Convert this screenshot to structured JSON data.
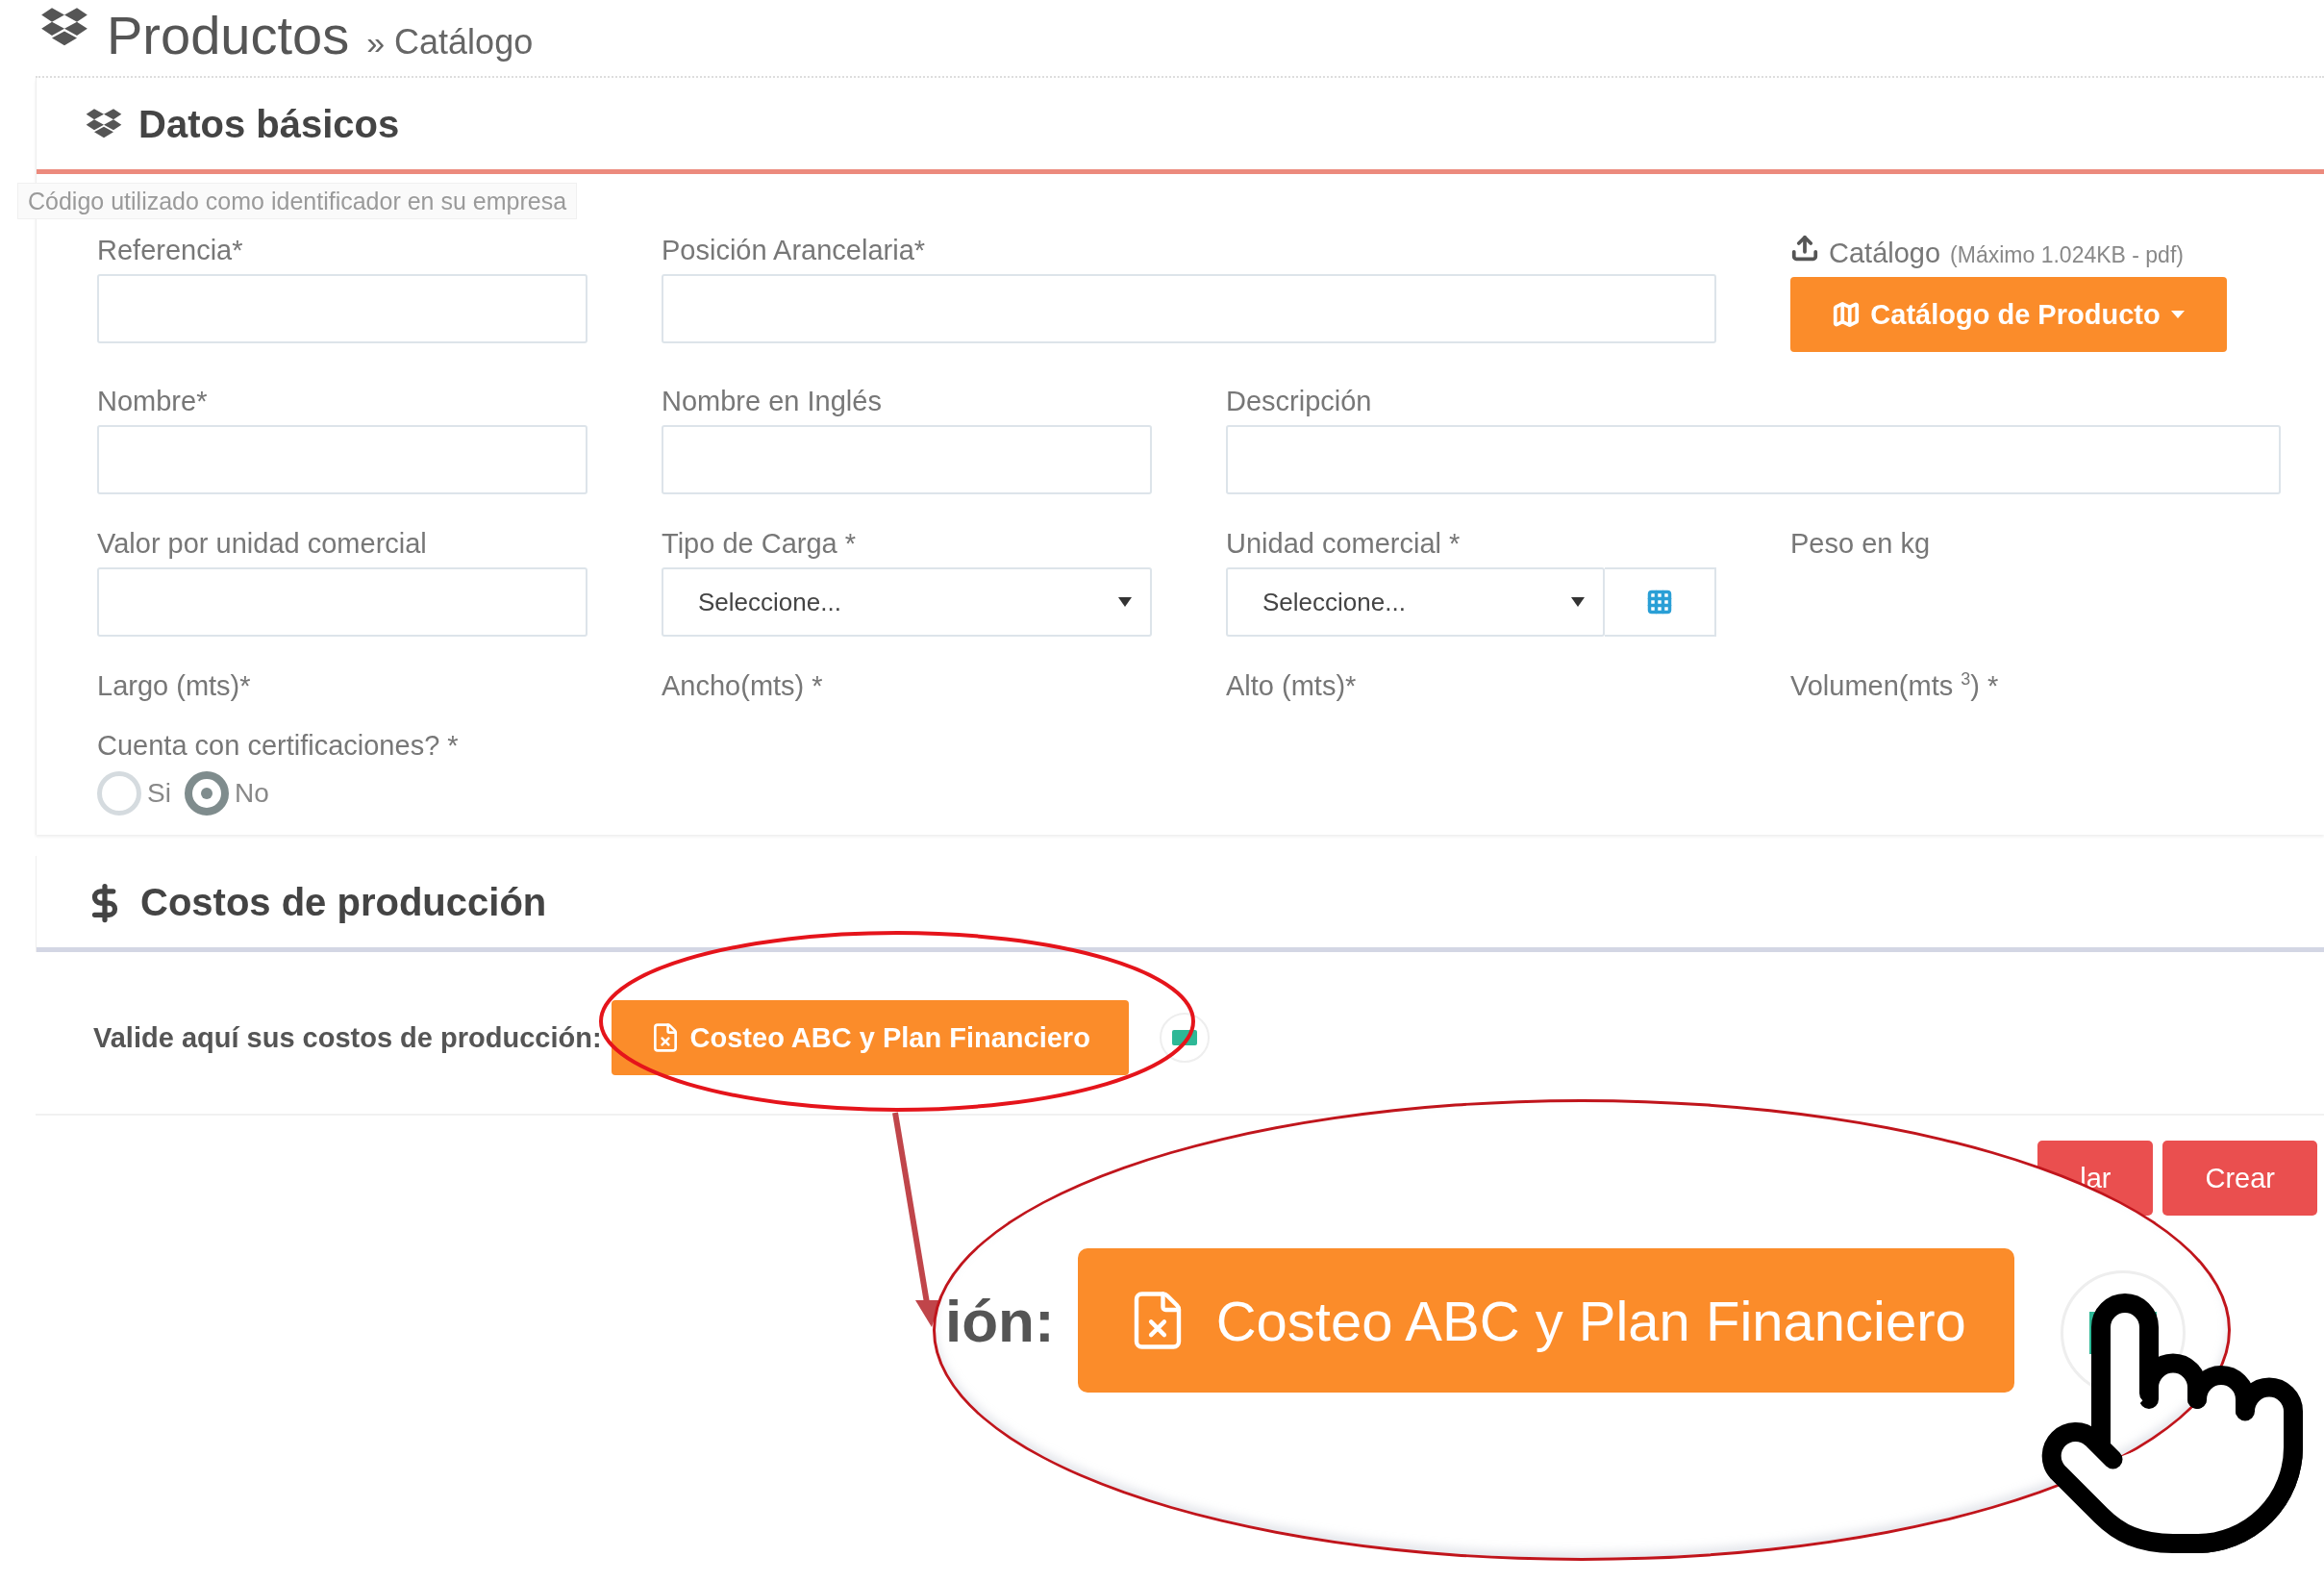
{
  "page_header": {
    "title": "Productos",
    "separator": "»",
    "breadcrumb": "Catálogo"
  },
  "tooltip": {
    "text": "Código utilizado como identificador en su empresa"
  },
  "basic_data": {
    "title": "Datos básicos",
    "rows": [
      [
        {
          "kind": "input",
          "label": "Referencia*"
        },
        {
          "kind": "wide_input",
          "label": "Posición Arancelaria*"
        },
        "",
        {
          "kind": "upload",
          "label": "Catálogo",
          "note": "(Máximo 1.024KB - pdf)",
          "button": "Catálogo de Producto"
        }
      ],
      [
        {
          "kind": "input",
          "label": "Nombre*"
        },
        {
          "kind": "input",
          "label": "Nombre en Inglés"
        },
        {
          "kind": "wide_input",
          "label": "Descripción"
        }
      ],
      [
        {
          "kind": "input",
          "label": "Valor por unidad comercial"
        },
        {
          "kind": "select",
          "label": "Tipo de Carga *",
          "value": "Seleccione..."
        },
        {
          "kind": "select_addon",
          "label": "Unidad comercial *",
          "value": "Seleccione..."
        },
        {
          "kind": "label",
          "label": "Peso en kg"
        }
      ],
      [
        {
          "kind": "label",
          "label": "Largo (mts)*"
        },
        {
          "kind": "label",
          "label": "Ancho(mts) *"
        },
        {
          "kind": "label",
          "label": "Alto (mts)*"
        },
        {
          "kind": "label",
          "label": "Volumen(mts $^{3}$) *"
        }
      ]
    ],
    "certifications": {
      "label": "Cuenta con certificaciones? *",
      "options": [
        {
          "label": "Si",
          "selected": false
        },
        {
          "label": "No",
          "selected": true
        }
      ]
    }
  },
  "production_costs": {
    "title": "Costos de producción",
    "prompt": "Valide aquí sus costos de producción:",
    "button": "Costeo ABC y Plan Financiero"
  },
  "actions": [
    {
      "label": "lar"
    },
    {
      "label": "Crear"
    }
  ],
  "zoom_inset": {
    "label": "ión:",
    "button": "Costeo ABC y Plan Financiero"
  }
}
